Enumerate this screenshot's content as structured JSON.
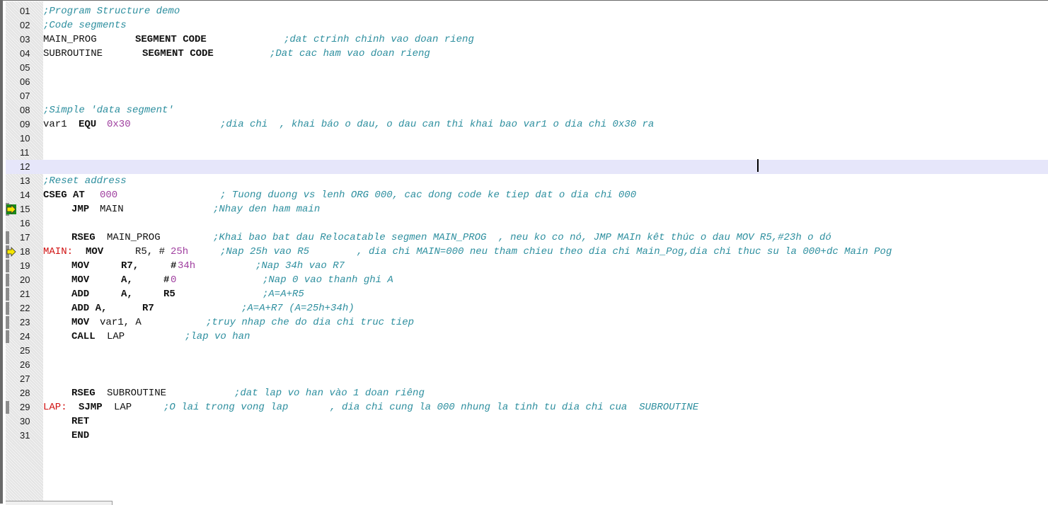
{
  "editor": {
    "colors": {
      "keyword": "#111111",
      "number": "#a040a0",
      "label": "#d01010",
      "comment": "#2e8f9f",
      "current_line": "#e6e6fa",
      "gutter": "#e4e4e4"
    },
    "lines": [
      {
        "num": "01",
        "tokens": [
          {
            "t": "cmt",
            "text": ";Program Structure demo"
          }
        ]
      },
      {
        "num": "02",
        "tokens": [
          {
            "t": "cmt",
            "text": ";Code segments"
          }
        ]
      },
      {
        "num": "03",
        "tokens": [
          {
            "t": "id",
            "text": "MAIN_PROG"
          },
          {
            "t": "kw",
            "text": "SEGMENT CODE",
            "col": 13
          },
          {
            "t": "cmt",
            "text": ";dat ctrinh chinh vao doan rieng",
            "col": 34
          }
        ]
      },
      {
        "num": "04",
        "tokens": [
          {
            "t": "id",
            "text": "SUBROUTINE"
          },
          {
            "t": "kw",
            "text": "SEGMENT CODE",
            "col": 14
          },
          {
            "t": "cmt",
            "text": ";Dat cac ham vao doan rieng",
            "col": 32
          }
        ]
      },
      {
        "num": "05",
        "tokens": []
      },
      {
        "num": "06",
        "tokens": []
      },
      {
        "num": "07",
        "tokens": []
      },
      {
        "num": "08",
        "tokens": [
          {
            "t": "cmt",
            "text": ";Simple 'data segment'"
          }
        ]
      },
      {
        "num": "09",
        "tokens": [
          {
            "t": "id",
            "text": "var1 "
          },
          {
            "t": "kw",
            "text": "EQU ",
            "col": 5
          },
          {
            "t": "num",
            "text": "0x30",
            "col": 9
          },
          {
            "t": "cmt",
            "text": ";dia chi  , khai báo o dau, o dau can thi khai bao var1 o dia chi 0x30 ra",
            "col": 25
          }
        ]
      },
      {
        "num": "10",
        "tokens": []
      },
      {
        "num": "11",
        "tokens": []
      },
      {
        "num": "12",
        "tokens": [],
        "current": true
      },
      {
        "num": "13",
        "tokens": [
          {
            "t": "cmt",
            "text": ";Reset address"
          }
        ]
      },
      {
        "num": "14",
        "tokens": [
          {
            "t": "kw",
            "text": "CSEG AT "
          },
          {
            "t": "num",
            "text": "000",
            "col": 8
          },
          {
            "t": "cmt",
            "text": "; Tuong duong vs lenh ORG 000, cac dong code ke tiep dat o dia chi 000",
            "col": 25
          }
        ]
      },
      {
        "num": "15",
        "marker": "current",
        "tokens": [
          {
            "t": "kw",
            "text": "JMP ",
            "col": 4
          },
          {
            "t": "id",
            "text": "MAIN",
            "col": 8
          },
          {
            "t": "cmt",
            "text": ";Nhay den ham main",
            "col": 24
          }
        ]
      },
      {
        "num": "16",
        "tokens": []
      },
      {
        "num": "17",
        "tokens": [
          {
            "t": "kw",
            "text": "RSEG ",
            "col": 4
          },
          {
            "t": "id",
            "text": "MAIN_PROG",
            "col": 9
          },
          {
            "t": "cmt",
            "text": ";Khai bao bat dau Relocatable segmen MAIN_PROG  , neu ko co nó, JMP MAIn kêt thúc o dau MOV R5,#23h o dó",
            "col": 24
          }
        ]
      },
      {
        "num": "18",
        "marker": "next",
        "tokens": [
          {
            "t": "lbl",
            "text": "MAIN:"
          },
          {
            "t": "kw",
            "text": "MOV",
            "col": 6
          },
          {
            "t": "id",
            "text": "R5, #",
            "col": 13
          },
          {
            "t": "num",
            "text": "25h",
            "col": 18
          },
          {
            "t": "cmt",
            "text": ";Nap 25h vao R5        , dia chi MAIN=000 neu tham chieu theo dia chi Main_Pog,dia chi thuc su la 000+dc Main Pog",
            "col": 25
          }
        ]
      },
      {
        "num": "19",
        "tokens": [
          {
            "t": "kw",
            "text": "MOV",
            "col": 4
          },
          {
            "t": "kw",
            "text": "R7,",
            "col": 11
          },
          {
            "t": "kw",
            "text": "#",
            "col": 18
          },
          {
            "t": "num",
            "text": "34h",
            "col": 19
          },
          {
            "t": "cmt",
            "text": ";Nap 34h vao R7",
            "col": 30
          }
        ]
      },
      {
        "num": "20",
        "tokens": [
          {
            "t": "kw",
            "text": "MOV",
            "col": 4
          },
          {
            "t": "kw",
            "text": "A,",
            "col": 11
          },
          {
            "t": "kw",
            "text": "#",
            "col": 17
          },
          {
            "t": "num",
            "text": "0",
            "col": 18
          },
          {
            "t": "cmt",
            "text": ";Nap 0 vao thanh ghi A",
            "col": 31
          }
        ]
      },
      {
        "num": "21",
        "tokens": [
          {
            "t": "kw",
            "text": "ADD",
            "col": 4
          },
          {
            "t": "kw",
            "text": "A,",
            "col": 11
          },
          {
            "t": "kw",
            "text": "R5",
            "col": 17
          },
          {
            "t": "cmt",
            "text": ";A=A+R5",
            "col": 31
          }
        ]
      },
      {
        "num": "22",
        "tokens": [
          {
            "t": "kw",
            "text": "ADD A,",
            "col": 4
          },
          {
            "t": "kw",
            "text": "R7",
            "col": 14
          },
          {
            "t": "cmt",
            "text": ";A=A+R7 (A=25h+34h)",
            "col": 28
          }
        ]
      },
      {
        "num": "23",
        "tokens": [
          {
            "t": "kw",
            "text": "MOV ",
            "col": 4
          },
          {
            "t": "id",
            "text": "var1, A",
            "col": 8
          },
          {
            "t": "cmt",
            "text": ";truy nhap che do dia chi truc tiep",
            "col": 23
          }
        ]
      },
      {
        "num": "24",
        "tokens": [
          {
            "t": "kw",
            "text": "CALL ",
            "col": 4
          },
          {
            "t": "id",
            "text": "LAP",
            "col": 9
          },
          {
            "t": "cmt",
            "text": ";lap vo han",
            "col": 20
          }
        ]
      },
      {
        "num": "25",
        "tokens": []
      },
      {
        "num": "26",
        "tokens": []
      },
      {
        "num": "27",
        "tokens": []
      },
      {
        "num": "28",
        "tokens": [
          {
            "t": "kw",
            "text": "RSEG ",
            "col": 4
          },
          {
            "t": "id",
            "text": "SUBROUTINE",
            "col": 9
          },
          {
            "t": "cmt",
            "text": ";dat lap vo han vào 1 doan riêng",
            "col": 27
          }
        ]
      },
      {
        "num": "29",
        "tokens": [
          {
            "t": "lbl",
            "text": "LAP:"
          },
          {
            "t": "kw",
            "text": "SJMP ",
            "col": 5
          },
          {
            "t": "id",
            "text": "LAP",
            "col": 10
          },
          {
            "t": "cmt",
            "text": ";O lai trong vong lap       , dia chi cung la 000 nhung la tinh tu dia chi cua  SUBROUTINE",
            "col": 17
          }
        ]
      },
      {
        "num": "30",
        "tokens": [
          {
            "t": "kw",
            "text": "RET",
            "col": 4
          }
        ]
      },
      {
        "num": "31",
        "tokens": [
          {
            "t": "kw",
            "text": "END",
            "col": 4
          }
        ]
      }
    ]
  }
}
